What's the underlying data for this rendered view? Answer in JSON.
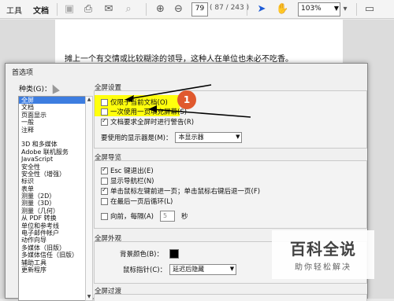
{
  "toolbar": {
    "tab_tools": "工具",
    "tab_document": "文档",
    "page_number": "79",
    "page_count": "( 87 / 243 )",
    "zoom": "103%"
  },
  "document": {
    "line": "摊上一个有交情或比较糊涂的领导，这种人在单位也未必不吃香。"
  },
  "dialog": {
    "title": "首选项",
    "category_label": "种类(G)：",
    "categories": [
      "全屏",
      "文档",
      "页面显示",
      "一般",
      "注释",
      "",
      "3D 和多媒体",
      "Adobe 联机服务",
      "JavaScript",
      "安全性",
      "安全性（增强）",
      "标识",
      "表单",
      "测量（2D）",
      "测量（3D）",
      "测量（几何）",
      "从 PDF 转换",
      "单位和参考线",
      "电子邮件帐户",
      "动作向导",
      "多媒体（旧版）",
      "多媒体信任（旧版）",
      "辅助工具",
      "更新程序"
    ],
    "fullscreen_setup": {
      "header": "全屏设置",
      "opt_current_doc": "仅限于当前文档(O)",
      "opt_one_page": "一次使用一页填充屏幕(S)",
      "opt_warn": "文档要求全屏时进行警告(R)",
      "monitor_label": "要使用的显示器是(M)：",
      "monitor_value": "本显示器"
    },
    "fullscreen_nav": {
      "header": "全屏导览",
      "opt_esc": "Esc 键退出(E)",
      "opt_nav_bar": "显示导航栏(N)",
      "opt_click": "单击鼠标左键前进一页；单击鼠标右键后退一页(F)",
      "opt_loop": "在最后一页后循环(L)",
      "opt_advance": "向前，每隔(A)",
      "advance_value": "5",
      "advance_unit": "秒"
    },
    "fullscreen_appearance": {
      "header": "全屏外观",
      "bg_label": "背景颜色(B)：",
      "pointer_label": "鼠标指针(C)：",
      "pointer_value": "延迟后隐藏"
    },
    "fullscreen_transition": {
      "header": "全屏过渡"
    }
  },
  "annotation": {
    "badge": "1"
  },
  "watermark": {
    "title": "百科全说",
    "subtitle": "助你轻松解决"
  },
  "colors": {
    "highlight": "#ffff00",
    "badge": "#e0592e",
    "selection": "#3d7de0"
  }
}
